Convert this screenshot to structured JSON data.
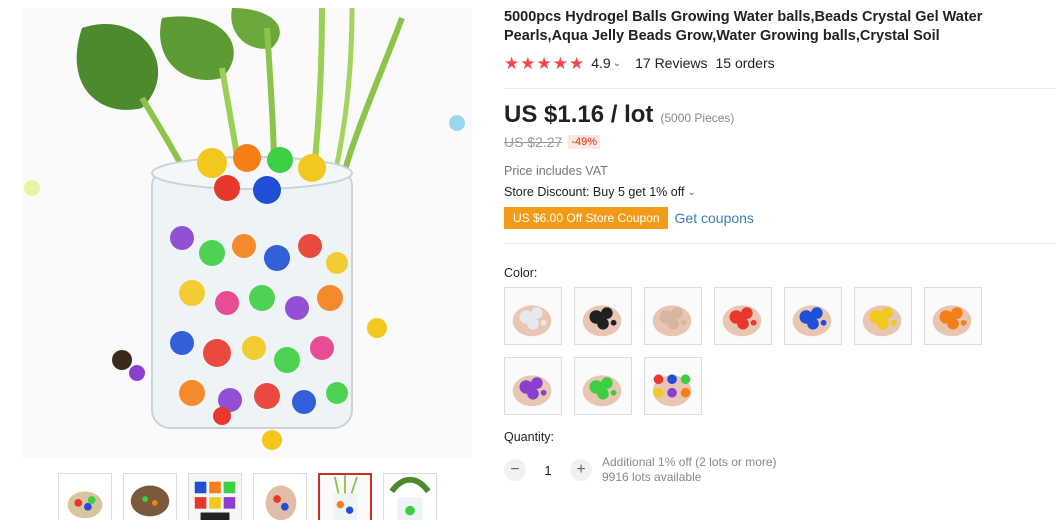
{
  "product": {
    "title": "5000pcs Hydrogel Balls Growing Water balls,Beads Crystal Gel Water Pearls,Aqua Jelly Beads Grow,Water Growing balls,Crystal Soil",
    "rating": "4.9",
    "stars": 5,
    "reviews": "17 Reviews",
    "orders": "15 orders"
  },
  "pricing": {
    "price": "US $1.16 / lot",
    "unit_note": "(5000 Pieces)",
    "original_price": "US $2.27",
    "discount": "-49%",
    "vat_note": "Price includes VAT",
    "store_discount": "Store Discount: Buy 5 get 1% off",
    "coupon": "US $6.00 Off Store Coupon",
    "get_coupons": "Get coupons"
  },
  "colors": {
    "label": "Color:",
    "options": [
      {
        "name": "white",
        "hex": "#e8e8ee"
      },
      {
        "name": "black",
        "hex": "#202020"
      },
      {
        "name": "skin",
        "hex": "#d9b4a4"
      },
      {
        "name": "red",
        "hex": "#e8382c"
      },
      {
        "name": "blue",
        "hex": "#1f4fd6"
      },
      {
        "name": "yellow",
        "hex": "#f2c81f"
      },
      {
        "name": "orange",
        "hex": "#f57f17"
      },
      {
        "name": "purple",
        "hex": "#8a3fd1"
      },
      {
        "name": "green",
        "hex": "#3dcf43"
      },
      {
        "name": "mixed",
        "hex": "#b0b0b0"
      }
    ]
  },
  "quantity": {
    "label": "Quantity:",
    "value": "1",
    "minus": "−",
    "plus": "+",
    "note_line1": "Additional 1% off (2 lots or more)",
    "note_line2": "9916 lots available"
  },
  "gallery": {
    "thumbnail_count": 6,
    "active_thumbnail": 5
  },
  "icons": {
    "star": "star-icon",
    "chevron": "chevron-down-icon"
  }
}
